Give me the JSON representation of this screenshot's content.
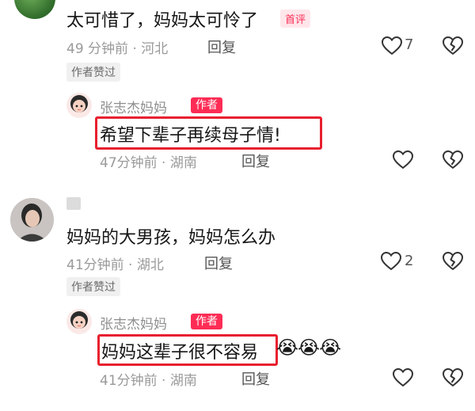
{
  "comments": [
    {
      "text": "太可惜了，妈妈太可怜了",
      "first_tag": "首评",
      "time_location": "49 分钟前 · 河北",
      "reply_label": "回复",
      "like_count": "7",
      "author_liked_badge": "作者赞过"
    },
    {
      "text": "妈妈的大男孩，妈妈怎么办",
      "time_location": "41分钟前 · 湖北",
      "reply_label": "回复",
      "like_count": "2",
      "author_liked_badge": "作者赞过"
    }
  ],
  "replies": [
    {
      "username": "张志杰妈妈",
      "author_tag": "作者",
      "text": "希望下辈子再续母子情!",
      "time_location": "47分钟前 · 湖南",
      "reply_label": "回复"
    },
    {
      "username": "张志杰妈妈",
      "author_tag": "作者",
      "text": "妈妈这辈子很不容易",
      "emojis": "😭😭😭",
      "time_location": "41分钟前 · 湖南",
      "reply_label": "回复"
    }
  ],
  "colors": {
    "author_red": "#fe2c55",
    "highlight_box": "#e8202f"
  }
}
